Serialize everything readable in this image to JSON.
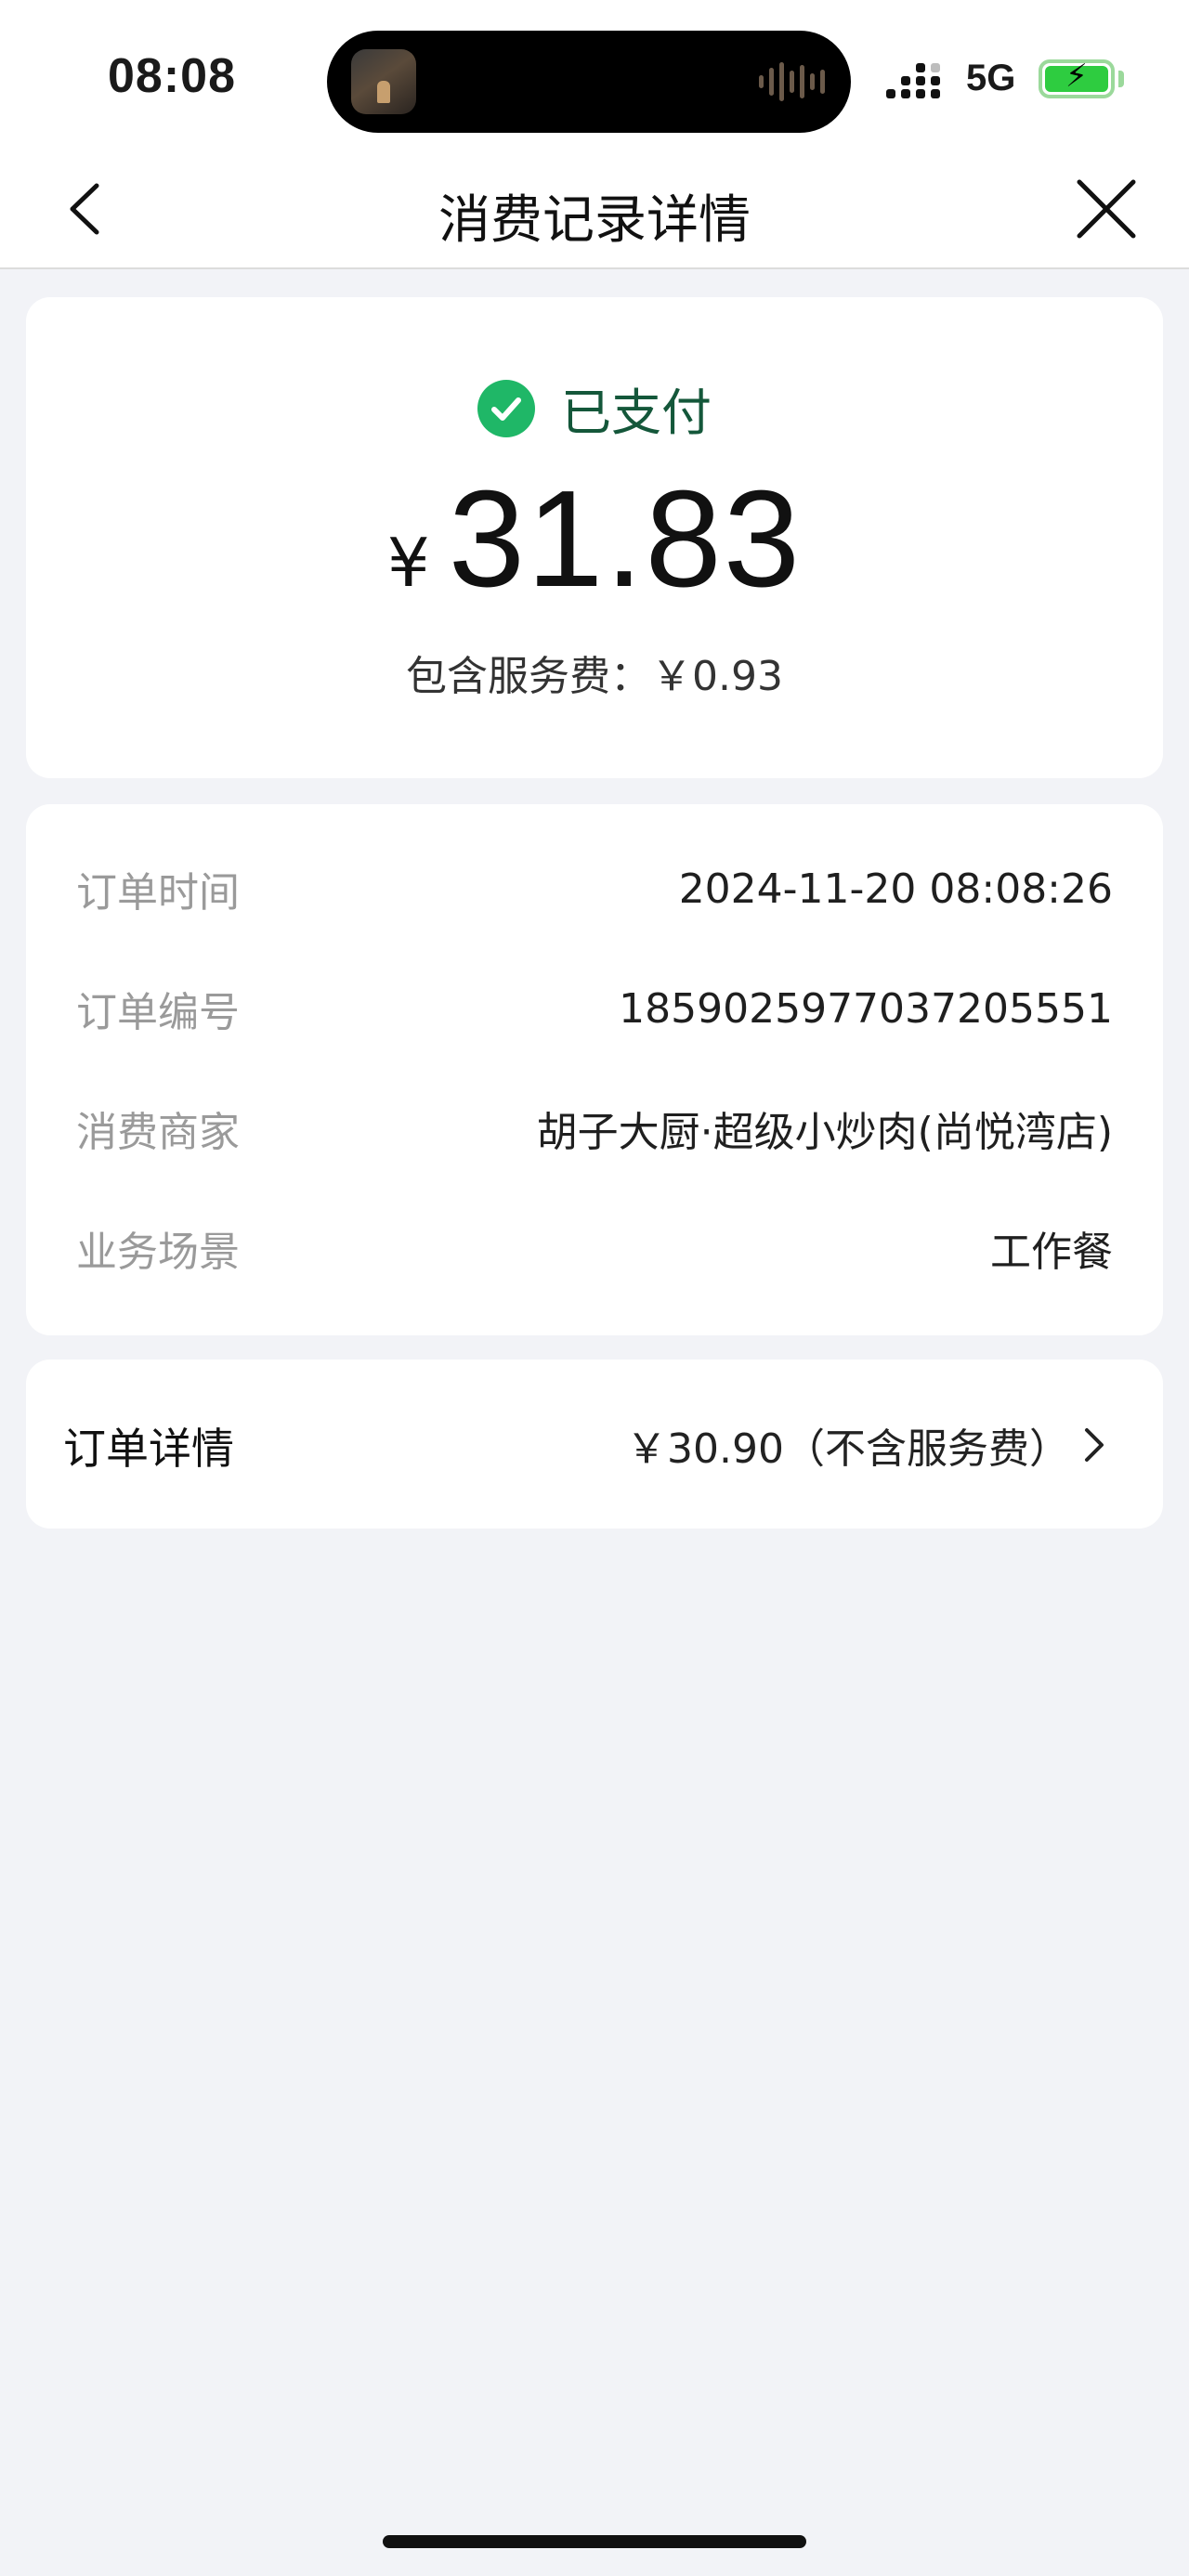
{
  "status_bar": {
    "time": "08:08",
    "network": "5G"
  },
  "nav": {
    "title": "消费记录详情"
  },
  "payment": {
    "status": "已支付",
    "currency_symbol": "¥",
    "amount": "31.83",
    "service_fee_text": "包含服务费：￥0.93"
  },
  "order_info": {
    "rows": [
      {
        "label": "订单时间",
        "value": "2024-11-20 08:08:26"
      },
      {
        "label": "订单编号",
        "value": "1859025977037205551"
      },
      {
        "label": "消费商家",
        "value": "胡子大厨·超级小炒肉(尚悦湾店)"
      },
      {
        "label": "业务场景",
        "value": "工作餐"
      }
    ]
  },
  "order_detail": {
    "label": "订单详情",
    "value": "￥30.90（不含服务费）"
  },
  "colors": {
    "accent_green": "#1fb767",
    "status_text_green": "#14573a",
    "background": "#f2f3f7"
  }
}
